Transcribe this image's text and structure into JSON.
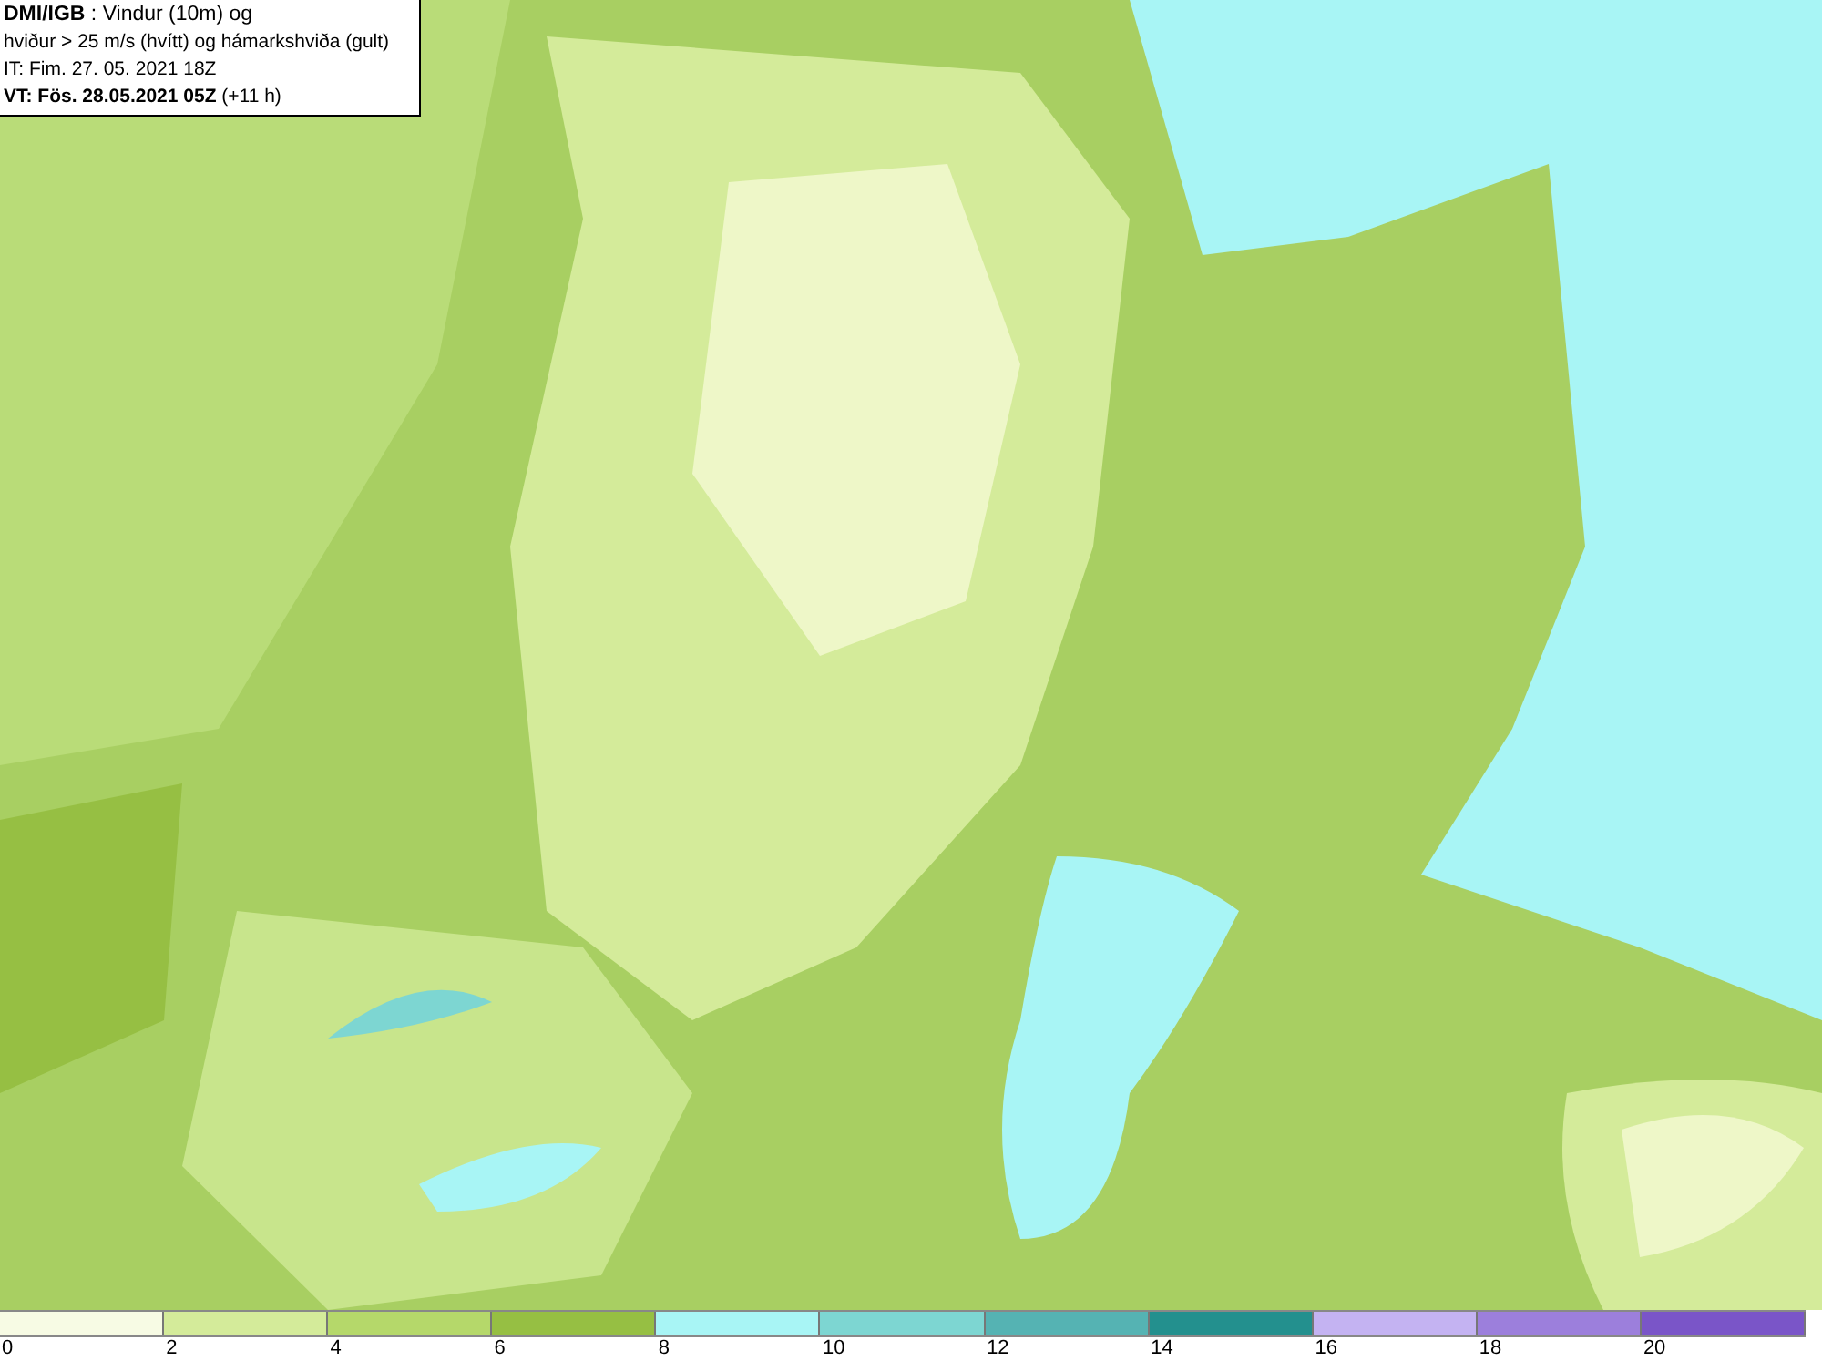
{
  "header": {
    "lines": [
      "**DMI/IGB** : Vindur (10m) og",
      "hviður > 25 m/s (hvítt) og hámarkshviða (gult)",
      "IT: Fim. 27. 05. 2021 18Z",
      "**VT: Fös. 28.05.2021 05Z** (+11 h)"
    ]
  },
  "legend": {
    "bins": [
      {
        "color": "#f7fbe4"
      },
      {
        "color": "#d4eb9a"
      },
      {
        "color": "#b5d86a"
      },
      {
        "color": "#96bf43"
      },
      {
        "color": "#a8f5f5"
      },
      {
        "color": "#7dd6d2"
      },
      {
        "color": "#55b3b3"
      },
      {
        "color": "#23908e"
      },
      {
        "color": "#c4b3f2"
      },
      {
        "color": "#9c7fdc"
      },
      {
        "color": "#7a55c8"
      }
    ],
    "ticks": [
      "0",
      "2",
      "4",
      "6",
      "8",
      "10",
      "12",
      "14",
      "16",
      "18",
      "20"
    ]
  }
}
